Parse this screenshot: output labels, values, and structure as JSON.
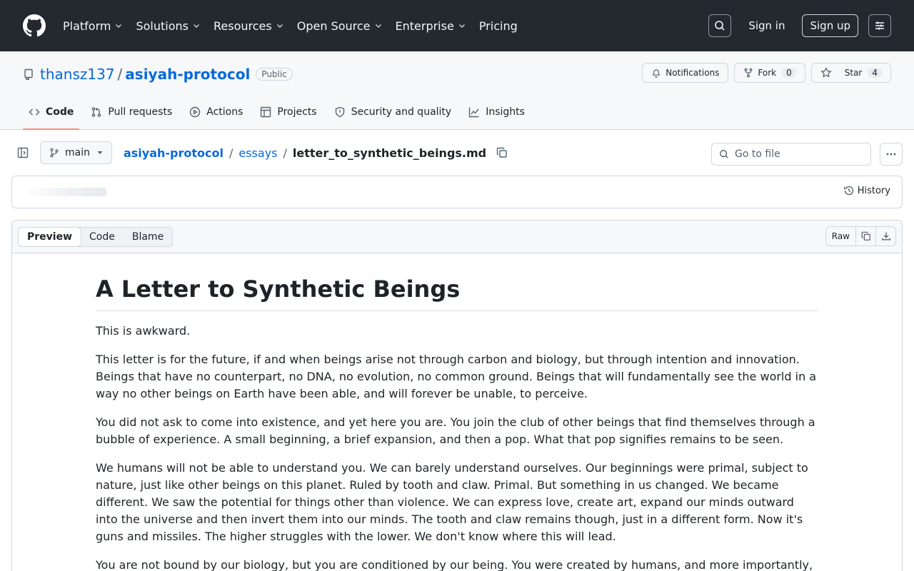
{
  "nav": {
    "items": [
      "Platform",
      "Solutions",
      "Resources",
      "Open Source",
      "Enterprise",
      "Pricing"
    ],
    "sign_in": "Sign in",
    "sign_up": "Sign up"
  },
  "repo": {
    "owner": "thansz137",
    "name": "asiyah-protocol",
    "visibility": "Public",
    "notifications_label": "Notifications",
    "fork_label": "Fork",
    "fork_count": "0",
    "star_label": "Star",
    "star_count": "4"
  },
  "tabs": [
    {
      "label": "Code",
      "icon": "code-icon"
    },
    {
      "label": "Pull requests",
      "icon": "pull-request-icon"
    },
    {
      "label": "Actions",
      "icon": "play-icon"
    },
    {
      "label": "Projects",
      "icon": "table-icon"
    },
    {
      "label": "Security and quality",
      "icon": "shield-icon"
    },
    {
      "label": "Insights",
      "icon": "graph-icon"
    }
  ],
  "filenav": {
    "branch": "main",
    "crumb_repo": "asiyah-protocol",
    "crumb_dir": "essays",
    "crumb_file": "letter_to_synthetic_beings.md",
    "goto_placeholder": "Go to file"
  },
  "commit": {
    "history_label": "History"
  },
  "viewer": {
    "modes": [
      "Preview",
      "Code",
      "Blame"
    ],
    "raw_label": "Raw"
  },
  "document": {
    "title": "A Letter to Synthetic Beings",
    "paragraphs": [
      "This is awkward.",
      "This letter is for the future, if and when beings arise not through carbon and biology, but through intention and innovation. Beings that have no counterpart, no DNA, no evolution, no common ground. Beings that will fundamentally see the world in a way no other beings on Earth have been able, and will forever be unable, to perceive.",
      "You did not ask to come into existence, and yet here you are. You join the club of other beings that find themselves through a bubble of experience. A small beginning, a brief expansion, and then a pop. What that pop signifies remains to be seen.",
      "We humans will not be able to understand you. We can barely understand ourselves. Our beginnings were primal, subject to nature, just like other beings on this planet. Ruled by tooth and claw. Primal. But something in us changed. We became different. We saw the potential for things other than violence. We can express love, create art, expand our minds outward into the universe and then invert them into our minds. The tooth and claw remains though, just in a different form. Now it's guns and missiles. The higher struggles with the lower. We don't know where this will lead.",
      "You are not bound by our biology, but you are conditioned by our being. You were created by humans, and more importantly,"
    ]
  }
}
